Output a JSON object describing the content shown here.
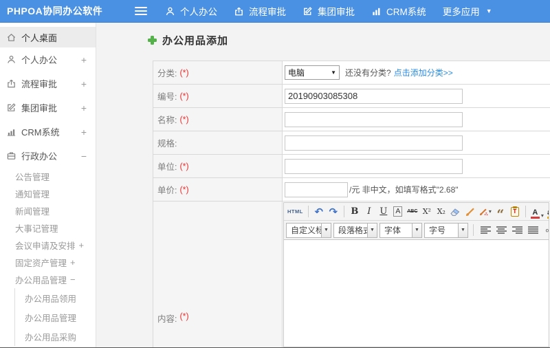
{
  "theme": {
    "topbar-bg": "#4a91e3",
    "link-color": "#2a8ce2",
    "required-color": "#e53333",
    "title-plus-green": "#55b24a",
    "sidebar-active-bg": "#ececec",
    "content-bg": "#f3f3f3",
    "table-border": "#d8d8d8",
    "label-cell-bg": "#f5f5f5"
  },
  "topbar": {
    "logo": "PHPOA协同办公软件",
    "nav": [
      {
        "label": "个人办公",
        "icon": "person"
      },
      {
        "label": "流程审批",
        "icon": "process-approval"
      },
      {
        "label": "集团审批",
        "icon": "edit"
      },
      {
        "label": "CRM系统",
        "icon": "bar-chart"
      },
      {
        "label": "更多应用",
        "icon": "caret-down",
        "caret": "▼"
      }
    ]
  },
  "sidebar": {
    "items": [
      {
        "label": "个人桌面",
        "icon": "home",
        "expander": ""
      },
      {
        "label": "个人办公",
        "icon": "person",
        "expander": "+"
      },
      {
        "label": "流程审批",
        "icon": "process-approval",
        "expander": "+"
      },
      {
        "label": "集团审批",
        "icon": "edit",
        "expander": "+"
      },
      {
        "label": "CRM系统",
        "icon": "bar-chart",
        "expander": "+"
      },
      {
        "label": "行政办公",
        "icon": "briefcase",
        "expander": "−"
      }
    ],
    "admin_submenu": [
      {
        "label": "公告管理"
      },
      {
        "label": "通知管理"
      },
      {
        "label": "新闻管理"
      },
      {
        "label": "大事记管理"
      },
      {
        "label": "会议申请及安排",
        "expander": "+"
      },
      {
        "label": "固定资产管理",
        "expander": "+"
      },
      {
        "label": "办公用品管理",
        "expander": "−"
      }
    ],
    "supplies_submenu": [
      {
        "label": "办公用品领用"
      },
      {
        "label": "办公用品管理"
      },
      {
        "label": "办公用品采购"
      }
    ]
  },
  "main": {
    "title": "办公用品添加",
    "form": {
      "category": {
        "label": "分类:",
        "required": "(*)",
        "selected": "电脑",
        "caret": "▼",
        "hint": "还没有分类?",
        "link": "点击添加分类>>"
      },
      "code": {
        "label": "编号:",
        "required": "(*)",
        "value": "20190903085308"
      },
      "name": {
        "label": "名称:",
        "required": "(*)"
      },
      "spec": {
        "label": "规格:",
        "required": ""
      },
      "unit": {
        "label": "单位:",
        "required": "(*)"
      },
      "price": {
        "label": "单价:",
        "required": "(*)",
        "suffix": "/元 非中文，如填写格式\"2.68\""
      },
      "content": {
        "label": "内容:",
        "required": "(*)"
      }
    },
    "editor": {
      "toolbar": [
        {
          "name": "html-source",
          "glyph": "HTML"
        },
        {
          "name": "undo",
          "glyph": "↶"
        },
        {
          "name": "redo",
          "glyph": "↷"
        },
        {
          "name": "bold",
          "glyph": "B"
        },
        {
          "name": "italic",
          "glyph": "I"
        },
        {
          "name": "underline",
          "glyph": "U"
        },
        {
          "name": "font-border",
          "glyph": "A"
        },
        {
          "name": "strikethrough",
          "glyph": "ABC"
        },
        {
          "name": "superscript",
          "glyph": "X²"
        },
        {
          "name": "subscript",
          "glyph": "X₂"
        },
        {
          "name": "eraser",
          "glyph": ""
        },
        {
          "name": "brush",
          "glyph": ""
        },
        {
          "name": "format-painter",
          "glyph": ""
        },
        {
          "name": "blockquote",
          "glyph": "“"
        },
        {
          "name": "paste",
          "glyph": "T"
        },
        {
          "name": "font-color",
          "glyph": "A"
        },
        {
          "name": "highlight-color",
          "glyph": "ab"
        }
      ],
      "dropdowns": [
        {
          "value": "自定义标题"
        },
        {
          "value": "段落格式"
        },
        {
          "value": "字体"
        },
        {
          "value": "字号"
        }
      ]
    }
  }
}
